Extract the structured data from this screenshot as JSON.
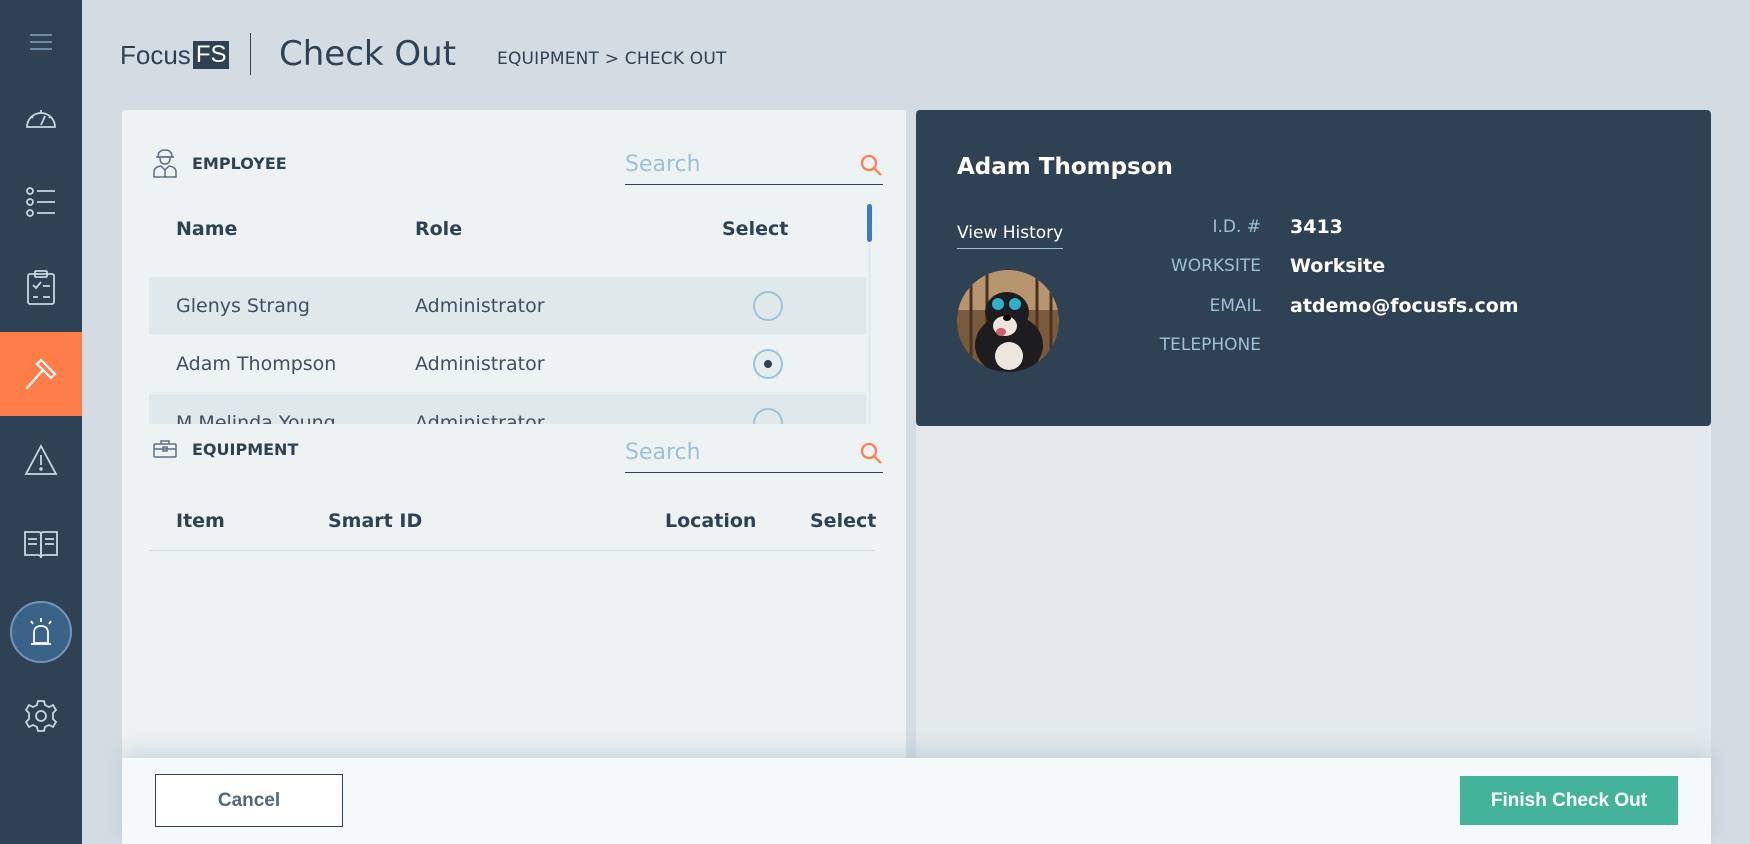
{
  "brand": {
    "name": "Focus",
    "box": "FS"
  },
  "header": {
    "title": "Check Out",
    "breadcrumb": "EQUIPMENT > CHECK OUT"
  },
  "sidebar": {
    "items": [
      {
        "name": "menu-icon"
      },
      {
        "name": "dashboard-icon"
      },
      {
        "name": "list-icon"
      },
      {
        "name": "checklist-icon"
      },
      {
        "name": "hammer-icon",
        "active": true
      },
      {
        "name": "warning-icon"
      },
      {
        "name": "book-icon"
      },
      {
        "name": "alarm-icon"
      },
      {
        "name": "gear-icon"
      }
    ]
  },
  "employee": {
    "heading": "EMPLOYEE",
    "search_placeholder": "Search",
    "columns": {
      "name": "Name",
      "role": "Role",
      "select": "Select"
    },
    "rows": [
      {
        "name": "Glenys Strang",
        "role": "Administrator",
        "selected": false
      },
      {
        "name": "Adam Thompson",
        "role": "Administrator",
        "selected": true
      },
      {
        "name": "M Melinda Young",
        "role": "Administrator",
        "selected": false
      }
    ]
  },
  "equipment": {
    "heading": "EQUIPMENT",
    "search_placeholder": "Search",
    "columns": {
      "item": "Item",
      "smart_id": "Smart ID",
      "location": "Location",
      "select": "Select"
    }
  },
  "profile": {
    "name": "Adam Thompson",
    "view_history": "View History",
    "labels": {
      "id": "I.D. #",
      "worksite": "WORKSITE",
      "email": "EMAIL",
      "telephone": "TELEPHONE"
    },
    "values": {
      "id": "3413",
      "worksite": "Worksite",
      "email": "atdemo@focusfs.com",
      "telephone": ""
    }
  },
  "footer": {
    "cancel": "Cancel",
    "finish": "Finish Check Out"
  },
  "colors": {
    "accent": "#ff7d49",
    "navy": "#2e4254",
    "success": "#43b39a",
    "muted": "#9dc1d8"
  }
}
